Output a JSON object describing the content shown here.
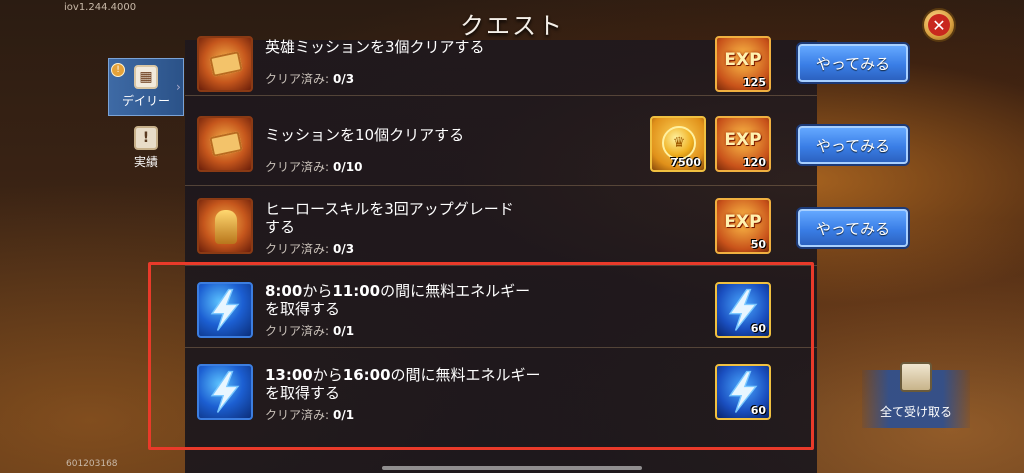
{
  "header": {
    "title": "クエスト",
    "version": "iov1.244.4000",
    "player_id": "601203168"
  },
  "tabs": [
    {
      "label": "デイリー",
      "selected": true,
      "icon": "calendar-icon",
      "badge": "!"
    },
    {
      "label": "実績",
      "selected": false,
      "icon": "achievement-icon"
    }
  ],
  "quests": [
    {
      "title": "英雄ミッションを3個クリアする",
      "progress_label": "クリア済み:",
      "progress": "0/3",
      "icon": "scroll-icon",
      "rewards": [
        {
          "type": "exp",
          "label": "EXP",
          "amount": "125"
        }
      ],
      "button": "やってみる"
    },
    {
      "title": "ミッションを10個クリアする",
      "progress_label": "クリア済み:",
      "progress": "0/10",
      "icon": "scroll-icon",
      "rewards": [
        {
          "type": "coin",
          "amount": "7500"
        },
        {
          "type": "exp",
          "label": "EXP",
          "amount": "120"
        }
      ],
      "button": "やってみる"
    },
    {
      "title_line1": "ヒーロースキルを3回アップグレード",
      "title_line2": "する",
      "progress_label": "クリア済み:",
      "progress": "0/3",
      "icon": "hero-icon",
      "rewards": [
        {
          "type": "exp",
          "label": "EXP",
          "amount": "50"
        }
      ],
      "button": "やってみる"
    },
    {
      "title_line1_a": "8:00",
      "title_line1_b": "から",
      "title_line1_c": "11:00",
      "title_line1_d": "の間に無料エネルギー",
      "title_line2": "を取得する",
      "progress_label": "クリア済み:",
      "progress": "0/1",
      "icon": "energy-icon",
      "rewards": [
        {
          "type": "energy",
          "amount": "60"
        }
      ]
    },
    {
      "title_line1_a": "13:00",
      "title_line1_b": "から",
      "title_line1_c": "16:00",
      "title_line1_d": "の間に無料エネルギー",
      "title_line2": "を取得する",
      "progress_label": "クリア済み:",
      "progress": "0/1",
      "icon": "energy-icon",
      "rewards": [
        {
          "type": "energy",
          "amount": "60"
        }
      ]
    }
  ],
  "claim_all": {
    "label": "全て受け取る",
    "icon": "chest-icon"
  },
  "colors": {
    "highlight": "#e93a2a",
    "button": "#3a7ee6",
    "tab_selected": "#3e6aa5"
  }
}
